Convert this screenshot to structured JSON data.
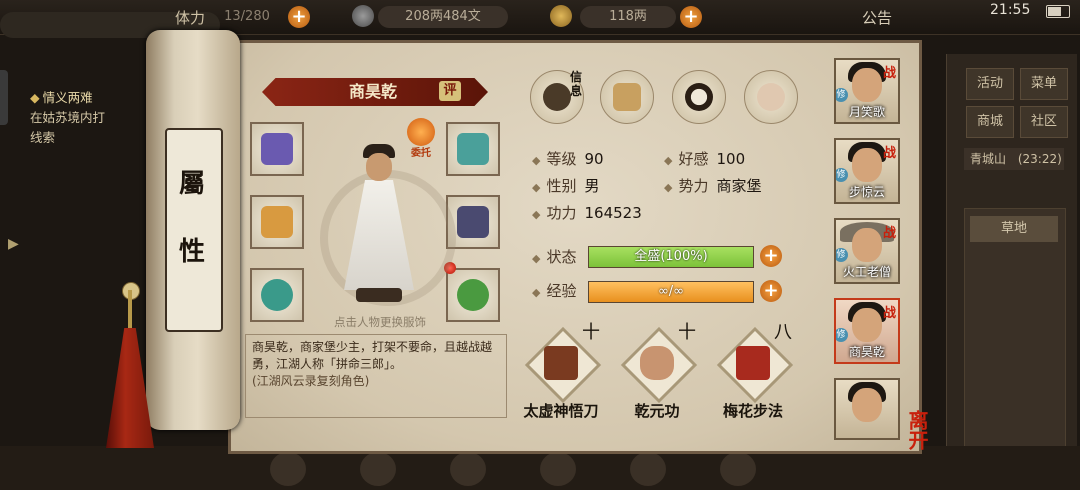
{
  "topbar": {
    "stamina": "13/280",
    "stamina_label": "体力",
    "copper": "208两484文",
    "silver": "118两",
    "announcement": "公告",
    "time": "21:55"
  },
  "background": {
    "quest_title": "情义两难",
    "quest_desc": "在姑苏境内打",
    "quest_desc2": "线索",
    "menu": [
      "活动",
      "菜单",
      "商城",
      "社区"
    ],
    "location": "青城山",
    "location_time": "(23:22)",
    "place": "草地"
  },
  "scroll": {
    "title_top": "屬",
    "title_bottom": "性"
  },
  "character": {
    "name": "商昊乾",
    "rate_label": "评",
    "entrust_label": "委托",
    "hint": "点击人物更换服饰",
    "description": "商昊乾，商家堡少主，打架不要命，且越战越勇，江湖人称「拼命三郎」。",
    "note": "(江湖风云录复刻角色)"
  },
  "tabs": [
    {
      "icon": "info-hat-icon",
      "label": "信息"
    },
    {
      "icon": "scroll-map-icon",
      "label": ""
    },
    {
      "icon": "yinyang-icon",
      "label": ""
    },
    {
      "icon": "meridian-body-icon",
      "label": ""
    }
  ],
  "stats": {
    "level_label": "等级",
    "level": "90",
    "affinity_label": "好感",
    "affinity": "100",
    "gender_label": "性别",
    "gender": "男",
    "faction_label": "势力",
    "faction": "商家堡",
    "power_label": "功力",
    "power": "164523",
    "state_label": "状态",
    "state_text": "全盛(100%)",
    "state_fill": 1.0,
    "exp_label": "经验",
    "exp_text": "∞/∞",
    "exp_fill": 1.0
  },
  "skills": [
    {
      "name": "太虚神悟刀",
      "level": "十"
    },
    {
      "name": "乾元功",
      "level": "十"
    },
    {
      "name": "梅花步法",
      "level": "八"
    }
  ],
  "roster": [
    {
      "name": "月笑歌",
      "tag": "战",
      "cult": "修"
    },
    {
      "name": "步惊云",
      "tag": "战",
      "cult": "修"
    },
    {
      "name": "火工老僧",
      "tag": "战",
      "cult": "修"
    },
    {
      "name": "商昊乾",
      "tag": "战",
      "cult": "修",
      "selected": true
    },
    {
      "name": "",
      "tag": "",
      "cult": ""
    }
  ],
  "leave_label": "离开",
  "colors": {
    "state_bar": "#7cc23a",
    "exp_bar": "#e8901e",
    "banner": "#8b2515",
    "accent_red": "#c8200c"
  }
}
